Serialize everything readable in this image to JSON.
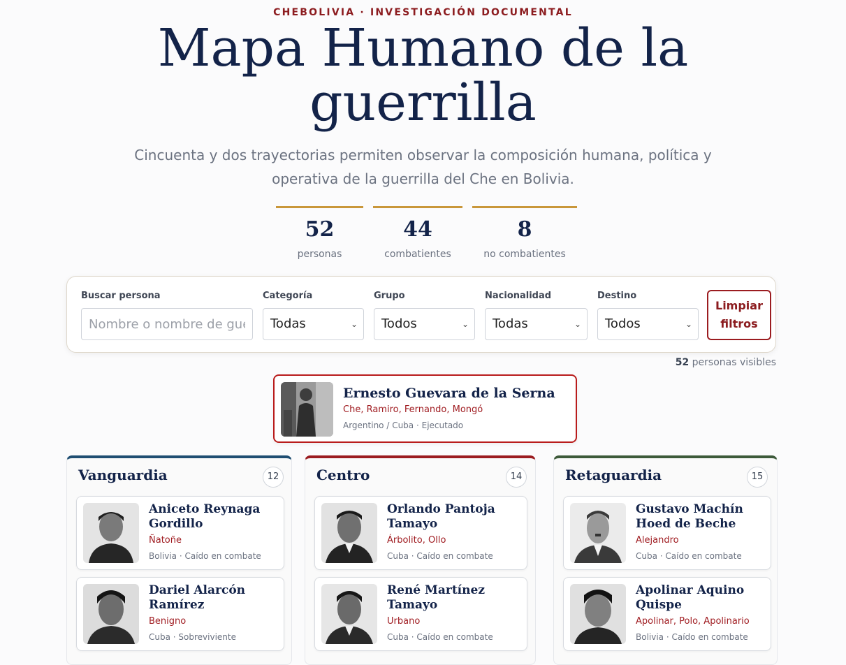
{
  "header": {
    "eyebrow": "CHEBOLIVIA · INVESTIGACIÓN DOCUMENTAL",
    "title_line1": "Mapa Humano de la",
    "title_line2": "guerrilla",
    "subtitle_line1": "Cincuenta y dos trayectorias permiten observar la composición humana, política y",
    "subtitle_line2": "operativa de la guerrilla del Che en Bolivia."
  },
  "stats": [
    {
      "value": "52",
      "label": "personas"
    },
    {
      "value": "44",
      "label": "combatientes"
    },
    {
      "value": "8",
      "label": "no combatientes"
    }
  ],
  "filters": {
    "search_label": "Buscar persona",
    "search_placeholder": "Nombre o nombre de guer",
    "categoria_label": "Categoría",
    "categoria_value": "Todas",
    "grupo_label": "Grupo",
    "grupo_value": "Todos",
    "nacionalidad_label": "Nacionalidad",
    "nacionalidad_value": "Todas",
    "destino_label": "Destino",
    "destino_value": "Todos",
    "clear_line1": "Limpiar",
    "clear_line2": "filtros"
  },
  "visible": {
    "count": "52",
    "label": "personas visibles"
  },
  "leader": {
    "name": "Ernesto Guevara de la Serna",
    "alias": "Che, Ramiro, Fernando, Mongó",
    "origin": "Argentino / Cuba",
    "fate": "Ejecutado"
  },
  "columns": [
    {
      "title": "Vanguardia",
      "count": "12",
      "color": "#1f4e72",
      "cards": [
        {
          "name": "Aniceto Reynaga Gordillo",
          "alias": "Ñatoñe",
          "meta": "Bolivia · Caído en combate"
        },
        {
          "name": "Dariel Alarcón Ramírez",
          "alias": "Benigno",
          "meta": "Cuba · Sobreviviente"
        }
      ]
    },
    {
      "title": "Centro",
      "count": "14",
      "color": "#9b1c20",
      "cards": [
        {
          "name": "Orlando Pantoja Tamayo",
          "alias": "Árbolito, Ollo",
          "meta": "Cuba · Caído en combate"
        },
        {
          "name": "René Martínez Tamayo",
          "alias": "Urbano",
          "meta": "Cuba · Caído en combate"
        }
      ]
    },
    {
      "title": "Retaguardia",
      "count": "15",
      "color": "#3d5a3a",
      "cards": [
        {
          "name": "Gustavo Machín Hoed de Beche",
          "alias": "Alejandro",
          "meta": "Cuba · Caído en combate"
        },
        {
          "name": "Apolinar Aquino Quispe",
          "alias": "Apolinar, Polo, Apolinario",
          "meta": "Bolivia · Caído en combate"
        }
      ]
    }
  ],
  "icons": {
    "select_arrow": "chevron-down-icon",
    "portrait": "portrait-photo"
  }
}
